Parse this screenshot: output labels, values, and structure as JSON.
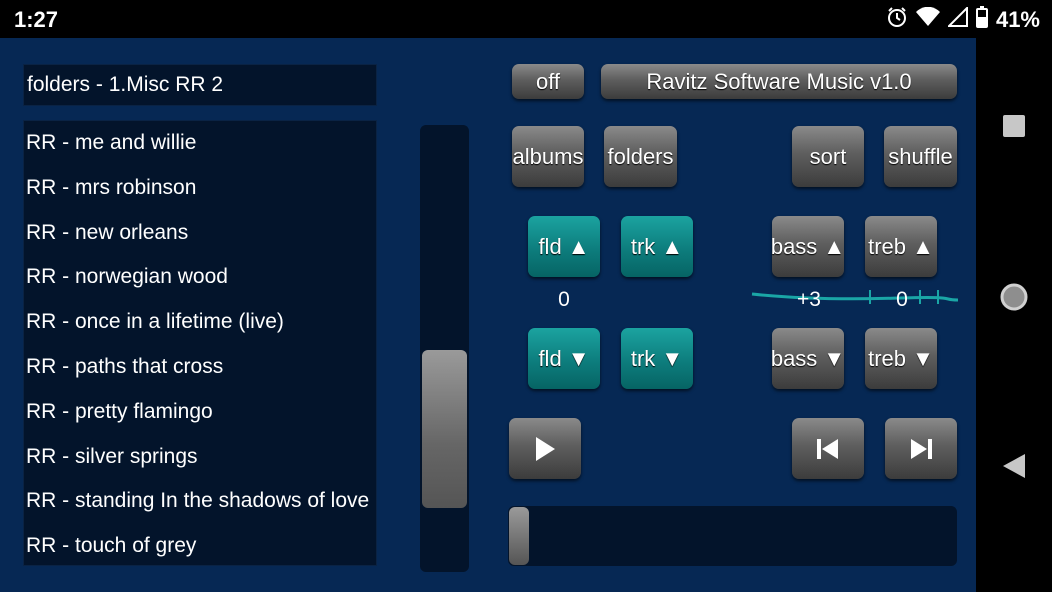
{
  "status_bar": {
    "time": "1:27",
    "battery_percent": "41%",
    "icons": [
      "alarm-icon",
      "wifi-icon",
      "signal-icon",
      "battery-icon"
    ]
  },
  "folder": {
    "title": "folders - 1.Misc RR 2"
  },
  "tracks": [
    "RR - me and willie",
    "RR - mrs robinson",
    "RR - new orleans",
    "RR - norwegian wood",
    "RR - once in a lifetime (live)",
    "RR - paths that cross",
    "RR - pretty flamingo",
    "RR - silver springs",
    "RR - standing In the shadows of love",
    "RR - touch of grey"
  ],
  "buttons": {
    "off": "off",
    "title": "Ravitz Software Music v1.0",
    "albums": "albums",
    "folders": "folders",
    "sort": "sort",
    "shuffle": "shuffle",
    "fld_up": "fld ▲",
    "trk_up": "trk ▲",
    "bass_up": "bass ▲",
    "treb_up": "treb ▲",
    "fld_down": "fld ▼",
    "trk_down": "trk ▼",
    "bass_down": "bass ▼",
    "treb_down": "treb ▼"
  },
  "values": {
    "fld_trk": "0",
    "bass": "+3",
    "treb": "0"
  },
  "playback": {
    "play_icon": "play-icon",
    "prev_icon": "skip-previous-icon",
    "next_icon": "skip-next-icon",
    "progress": 0.0
  },
  "colors": {
    "app_bg": "#062854",
    "teal": "#0d7d7d",
    "accent_line": "#1aa6a6"
  }
}
